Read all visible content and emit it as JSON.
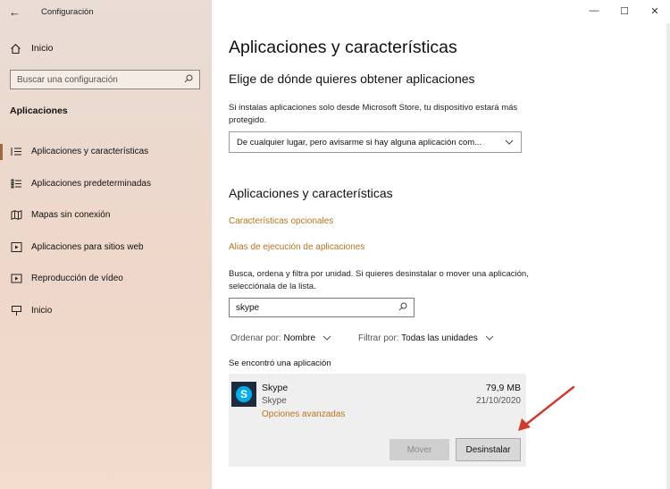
{
  "window": {
    "title": "Configuración",
    "back_icon": "back-arrow-icon",
    "minimize": "—",
    "maximize": "☐",
    "close": "✕"
  },
  "sidebar": {
    "home_label": "Inicio",
    "search_placeholder": "Buscar una configuración",
    "section_title": "Aplicaciones",
    "items": [
      {
        "label": "Aplicaciones y características",
        "icon": "list-icon",
        "active": true
      },
      {
        "label": "Aplicaciones predeterminadas",
        "icon": "default-apps-icon",
        "active": false
      },
      {
        "label": "Mapas sin conexión",
        "icon": "map-icon",
        "active": false
      },
      {
        "label": "Aplicaciones para sitios web",
        "icon": "web-apps-icon",
        "active": false
      },
      {
        "label": "Reproducción de vídeo",
        "icon": "video-icon",
        "active": false
      },
      {
        "label": "Inicio",
        "icon": "startup-icon",
        "active": false
      }
    ]
  },
  "main": {
    "page_title": "Aplicaciones y características",
    "source_heading": "Elige de dónde quieres obtener aplicaciones",
    "source_text": "Si instalas aplicaciones solo desde Microsoft Store, tu dispositivo estará más protegido.",
    "source_dropdown_value": "De cualquier lugar, pero avisarme si hay alguna aplicación com...",
    "apps_heading": "Aplicaciones y características",
    "link_optional": "Características opcionales",
    "link_alias": "Alias de ejecución de aplicaciones",
    "filter_text": "Busca, ordena y filtra por unidad. Si quieres desinstalar o mover una aplicación, selecciónala de la lista.",
    "filter_value": "skype",
    "sort_label": "Ordenar por:",
    "sort_value": "Nombre",
    "drive_label": "Filtrar por:",
    "drive_value": "Todas las unidades",
    "found_text": "Se encontró una aplicación",
    "app": {
      "name": "Skype",
      "publisher": "Skype",
      "advanced_link": "Opciones avanzadas",
      "size": "79,9 MB",
      "date": "21/10/2020",
      "icon_letter": "S"
    },
    "move_button": "Mover",
    "uninstall_button": "Desinstalar"
  },
  "colors": {
    "accent_link": "#b8751e",
    "annotation_arrow": "#d23a2c",
    "skype_blue": "#00aff0"
  }
}
